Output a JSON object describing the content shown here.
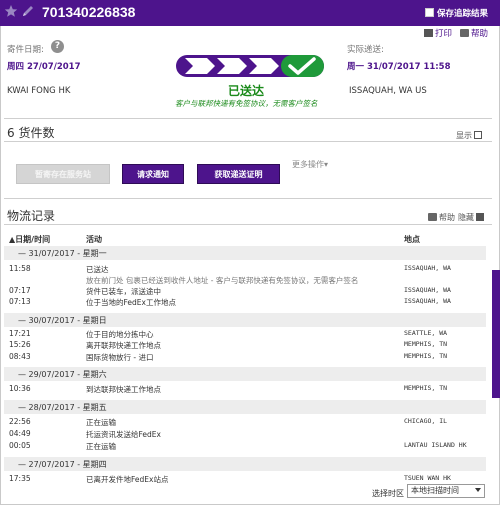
{
  "header": {
    "tracking_number": "701340226838",
    "save_results_label": "保存追踪结果"
  },
  "summary": {
    "ship_date_label": "寄件日期:",
    "ship_date": "周四 27/07/2017",
    "origin": "KWAI FONG HK",
    "print_label": "打印",
    "help_label": "帮助",
    "actual_delivery_label": "实际递送:",
    "actual_delivery": "周一 31/07/2017 11:58",
    "destination": "ISSAQUAH, WA US",
    "status": "已送达",
    "status_note": "客户与联邦快递有免签协议，无需客户签名",
    "progress_steps_total": 4,
    "progress_steps_done": 4
  },
  "pieces": {
    "title": "6 货件数",
    "show_label": "显示",
    "buttons": {
      "hold_label": "暂寄存在服务站",
      "request_label": "请求通知",
      "proof_label": "获取递送证明"
    },
    "more_label": "更多操作▾"
  },
  "history": {
    "title": "物流记录",
    "help_label": "帮助",
    "hide_label": "隐藏",
    "columns": {
      "date": "▲日期/时间",
      "activity": "活动",
      "location": "地点"
    },
    "days": [
      {
        "label": "—   31/07/2017  -  星期一",
        "events": [
          {
            "time": "11:58",
            "activity": "已送达",
            "location": "ISSAQUAH, WA"
          },
          {
            "time": "",
            "activity": "放在前门处 包裹已经送到收件人地址 - 客户与联邦快递有免签协议，无需客户签名",
            "location": "",
            "sub": true
          },
          {
            "time": "07:17",
            "activity": "货件已装车，派送途中",
            "location": "ISSAQUAH, WA"
          },
          {
            "time": "07:13",
            "activity": "位于当地的FedEx工作地点",
            "location": "ISSAQUAH, WA"
          }
        ]
      },
      {
        "label": "—   30/07/2017  -  星期日",
        "events": [
          {
            "time": "17:21",
            "activity": "位于目的地分拣中心",
            "location": "SEATTLE, WA"
          },
          {
            "time": "15:26",
            "activity": "离开联邦快递工作地点",
            "location": "MEMPHIS, TN"
          },
          {
            "time": "08:43",
            "activity": "国际货物放行 - 进口",
            "location": "MEMPHIS, TN"
          }
        ]
      },
      {
        "label": "—   29/07/2017  -  星期六",
        "events": [
          {
            "time": "10:36",
            "activity": "到达联邦快递工作地点",
            "location": "MEMPHIS, TN"
          }
        ]
      },
      {
        "label": "—   28/07/2017  -  星期五",
        "events": [
          {
            "time": "22:56",
            "activity": "正在运输",
            "location": "CHICAGO, IL"
          },
          {
            "time": "04:49",
            "activity": "托运资讯发送给FedEx",
            "location": ""
          },
          {
            "time": "00:05",
            "activity": "正在运输",
            "location": "LANTAU ISLAND HK"
          }
        ]
      },
      {
        "label": "—   27/07/2017  -  星期四",
        "events": [
          {
            "time": "17:35",
            "activity": "已离开发件地FedEx站点",
            "location": "TSUEN WAN HK"
          }
        ]
      }
    ]
  },
  "timezone": {
    "label": "选择时区",
    "selected": "本地扫描时间"
  },
  "colors": {
    "brand_purple": "#4d148c",
    "delivered_green": "#1a8a1a"
  },
  "icons": [
    "star-icon",
    "pencil-icon",
    "help-circle-icon",
    "print-icon",
    "help-icon",
    "checkmark-icon",
    "dropdown-arrow-icon"
  ]
}
